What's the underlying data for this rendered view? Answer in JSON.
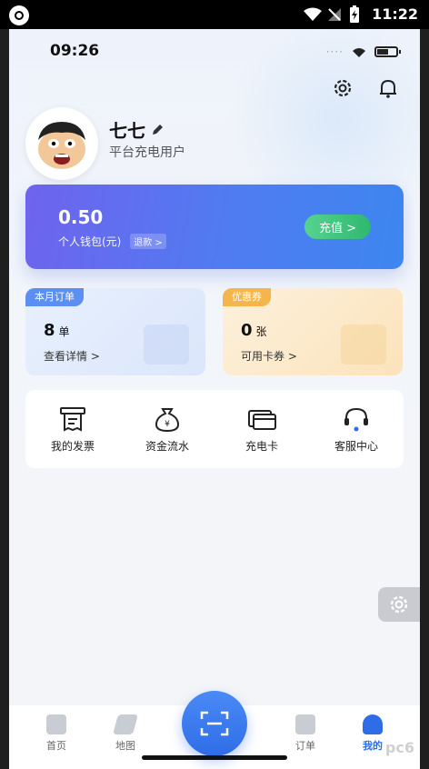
{
  "system_bar": {
    "time": "11:22"
  },
  "inner_status": {
    "time": "09:26"
  },
  "profile": {
    "name": "七七",
    "user_type": "平台充电用户"
  },
  "wallet": {
    "amount": "0.50",
    "label": "个人钱包(元)",
    "refund_label": "退款 >",
    "recharge_label": "充值 >"
  },
  "orders_card": {
    "tag": "本月订单",
    "count": "8",
    "unit": "单",
    "link": "查看详情 >"
  },
  "coupons_card": {
    "tag": "优惠券",
    "count": "0",
    "unit": "张",
    "link": "可用卡券 >"
  },
  "services": [
    {
      "label": "我的发票",
      "icon": "invoice-icon"
    },
    {
      "label": "资金流水",
      "icon": "money-bag-icon"
    },
    {
      "label": "充电卡",
      "icon": "card-icon"
    },
    {
      "label": "客服中心",
      "icon": "headset-icon"
    }
  ],
  "nav": {
    "home": "首页",
    "map": "地图",
    "orders": "订单",
    "mine": "我的"
  },
  "colors": {
    "wallet_gradient_start": "#6f63ee",
    "wallet_gradient_end": "#3d86f0",
    "recharge_green": "#2fb86f",
    "active_blue": "#2f6de8"
  }
}
